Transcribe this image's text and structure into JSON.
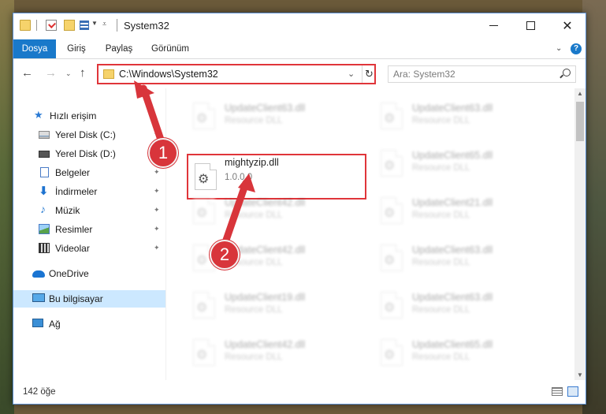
{
  "window": {
    "title": "System32",
    "controls": {
      "minimize": "minimize",
      "maximize": "maximize",
      "close": "✕"
    }
  },
  "ribbon": {
    "tabs": [
      "Dosya",
      "Giriş",
      "Paylaş",
      "Görünüm"
    ],
    "help": "?"
  },
  "address": {
    "path": "C:\\Windows\\System32",
    "search_placeholder": "Ara: System32"
  },
  "sidebar": {
    "items": [
      {
        "label": "Hızlı erişim",
        "icon": "star-icon",
        "pinned": false
      },
      {
        "label": "Yerel Disk (C:)",
        "icon": "drive-icon",
        "pinned": true
      },
      {
        "label": "Yerel Disk (D:)",
        "icon": "drive-icon",
        "pinned": true
      },
      {
        "label": "Belgeler",
        "icon": "document-icon",
        "pinned": true
      },
      {
        "label": "İndirmeler",
        "icon": "download-icon",
        "pinned": true
      },
      {
        "label": "Müzik",
        "icon": "music-icon",
        "pinned": true
      },
      {
        "label": "Resimler",
        "icon": "pictures-icon",
        "pinned": true
      },
      {
        "label": "Videolar",
        "icon": "video-icon",
        "pinned": true
      },
      {
        "label": "OneDrive",
        "icon": "cloud-icon",
        "pinned": false
      },
      {
        "label": "Bu bilgisayar",
        "icon": "computer-icon",
        "pinned": false,
        "selected": true
      },
      {
        "label": "Ağ",
        "icon": "network-icon",
        "pinned": false
      }
    ]
  },
  "files": [
    {
      "name": "UpdateClient63.dll",
      "sub": "Resource DLL",
      "state": "blurred"
    },
    {
      "name": "UpdateClient63.dll",
      "sub": "Resource DLL",
      "state": "blurred"
    },
    {
      "name": "mightyzip.dll",
      "sub": "1.0.0.0",
      "state": "highlighted"
    },
    {
      "name": "UpdateClient65.dll",
      "sub": "Resource DLL",
      "state": "blurred"
    },
    {
      "name": "UpdateClient42.dll",
      "sub": "Resource DLL",
      "state": "blurred"
    },
    {
      "name": "UpdateClient21.dll",
      "sub": "Resource DLL",
      "state": "blurred"
    },
    {
      "name": "UpdateClient42.dll",
      "sub": "Resource DLL",
      "state": "blurred"
    },
    {
      "name": "UpdateClient63.dll",
      "sub": "Resource DLL",
      "state": "blurred"
    },
    {
      "name": "UpdateClient19.dll",
      "sub": "Resource DLL",
      "state": "blurred"
    },
    {
      "name": "UpdateClient63.dll",
      "sub": "Resource DLL",
      "state": "blurred"
    },
    {
      "name": "UpdateClient42.dll",
      "sub": "Resource DLL",
      "state": "blurred"
    },
    {
      "name": "UpdateClient65.dll",
      "sub": "Resource DLL",
      "state": "blurred"
    }
  ],
  "status": {
    "count": "142 öğe"
  },
  "annotations": {
    "marker1": "1",
    "marker2": "2",
    "color": "#d8353b"
  },
  "colors": {
    "accent": "#1979ca",
    "highlight": "#e0353a",
    "selection": "#cce8ff"
  }
}
